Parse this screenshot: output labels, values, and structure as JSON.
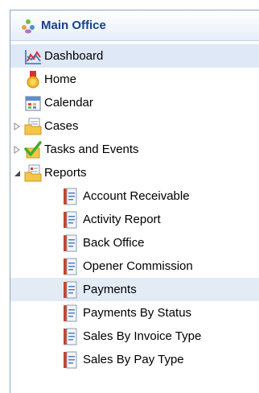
{
  "panel": {
    "title": "Main Office",
    "icon": "people-group-icon"
  },
  "tree": {
    "items": [
      {
        "label": "Dashboard",
        "icon": "dashboard-chart-icon"
      },
      {
        "label": "Home",
        "icon": "home-medal-icon"
      },
      {
        "label": "Calendar",
        "icon": "calendar-icon"
      },
      {
        "label": "Cases",
        "icon": "folder-document-icon",
        "expander": "collapsed"
      },
      {
        "label": "Tasks and Events",
        "icon": "checkmark-icon",
        "expander": "collapsed"
      },
      {
        "label": "Reports",
        "icon": "report-folder-icon",
        "expander": "expanded"
      },
      {
        "label": "Account Receivable",
        "icon": "report-icon"
      },
      {
        "label": "Activity Report",
        "icon": "report-icon"
      },
      {
        "label": "Back Office",
        "icon": "report-icon"
      },
      {
        "label": "Opener Commission",
        "icon": "report-icon"
      },
      {
        "label": "Payments",
        "icon": "report-icon"
      },
      {
        "label": "Payments By Status",
        "icon": "report-icon"
      },
      {
        "label": "Sales By Invoice Type",
        "icon": "report-icon"
      },
      {
        "label": "Sales By Pay Type",
        "icon": "report-icon"
      }
    ]
  },
  "colors": {
    "title": "#15428b",
    "selected_row": "#dfe8f6",
    "hover_row": "#e3ebf5",
    "border": "#8aa4c4"
  }
}
